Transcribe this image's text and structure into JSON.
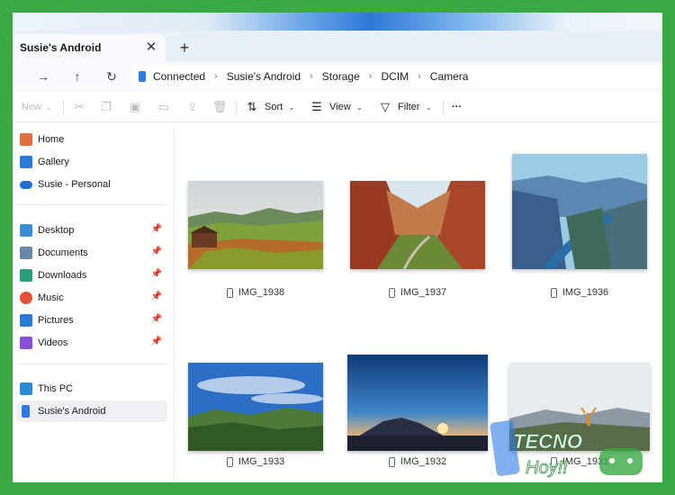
{
  "window": {
    "tab_title": "Susie's Android",
    "close_symbol": "✕",
    "new_tab_symbol": "+"
  },
  "address": {
    "breadcrumbs": [
      "Connected",
      "Susie's Android",
      "Storage",
      "DCIM",
      "Camera"
    ]
  },
  "toolbar": {
    "new_label": "New",
    "sort_label": "Sort",
    "view_label": "View",
    "filter_label": "Filter",
    "more_label": "···"
  },
  "sidebar": {
    "items": [
      {
        "label": "Home",
        "icon": "home-icon",
        "color": "#e2703a"
      },
      {
        "label": "Gallery",
        "icon": "gallery-icon",
        "color": "#2a7ad6"
      },
      {
        "label": "Susie - Personal",
        "icon": "cloud-icon",
        "color": "#1f6fd1"
      },
      {
        "label": "Desktop",
        "icon": "desktop-icon",
        "color": "#3a8fd8",
        "pinned": true
      },
      {
        "label": "Documents",
        "icon": "documents-icon",
        "color": "#6b87a8",
        "pinned": true
      },
      {
        "label": "Downloads",
        "icon": "downloads-icon",
        "color": "#2aa078",
        "pinned": true
      },
      {
        "label": "Music",
        "icon": "music-icon",
        "color": "#e2503a",
        "pinned": true
      },
      {
        "label": "Pictures",
        "icon": "pictures-icon",
        "color": "#2a7ad6",
        "pinned": true
      },
      {
        "label": "Videos",
        "icon": "videos-icon",
        "color": "#8a4fd8",
        "pinned": true
      },
      {
        "label": "This PC",
        "icon": "pc-icon",
        "color": "#2a8ad6"
      },
      {
        "label": "Susie's Android",
        "icon": "phone-icon",
        "color": "#2c7be5"
      }
    ]
  },
  "files": [
    {
      "name": "IMG_1938"
    },
    {
      "name": "IMG_1937"
    },
    {
      "name": "IMG_1936"
    },
    {
      "name": "IMG_1933"
    },
    {
      "name": "IMG_1932"
    },
    {
      "name": "IMG_1931"
    }
  ],
  "watermark": {
    "line1": "TECNO",
    "line2": "Hoy!!"
  },
  "colors": {
    "frame": "#3aa845",
    "accent": "#2c7be5"
  }
}
